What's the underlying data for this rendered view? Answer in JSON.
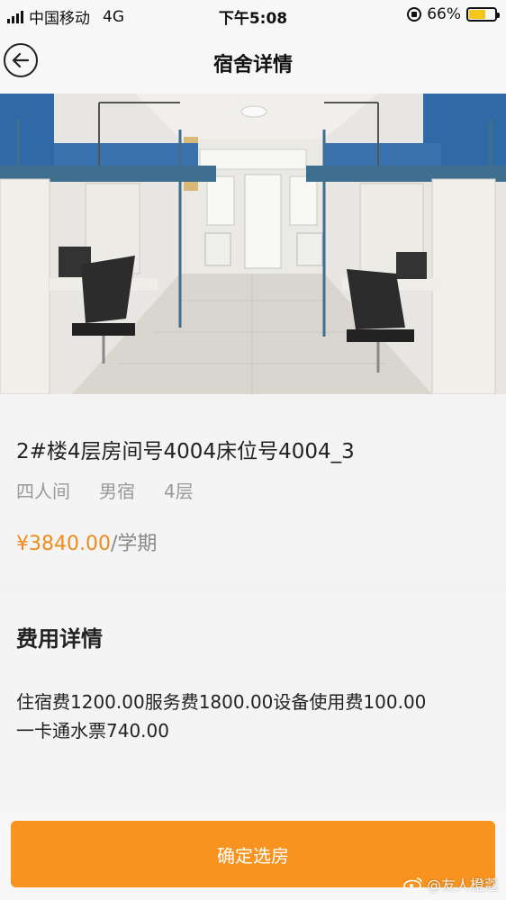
{
  "status_bar": {
    "carrier": "中国移动",
    "network": "4G",
    "time": "下午5:08",
    "battery_percent": "66%",
    "battery_level": 0.66
  },
  "nav": {
    "title": "宿舍详情",
    "back_icon": "back-arrow-icon"
  },
  "room_photo": {
    "alt": "宿舍照片"
  },
  "room": {
    "title": "2#楼4层房间号4004床位号4004_3",
    "tags": [
      "四人间",
      "男宿",
      "4层"
    ],
    "price": "¥3840.00",
    "price_unit": "/学期"
  },
  "fees": {
    "title": "费用详情",
    "line1": "住宿费1200.00服务费1800.00设备使用费100.00",
    "line2": "一卡通水票740.00"
  },
  "actions": {
    "confirm_label": "确定选房"
  },
  "watermark": {
    "text": "@友人橙蔻"
  },
  "colors": {
    "accent": "#f7931e",
    "price": "#f08a1c",
    "tag_gray": "#999999"
  }
}
